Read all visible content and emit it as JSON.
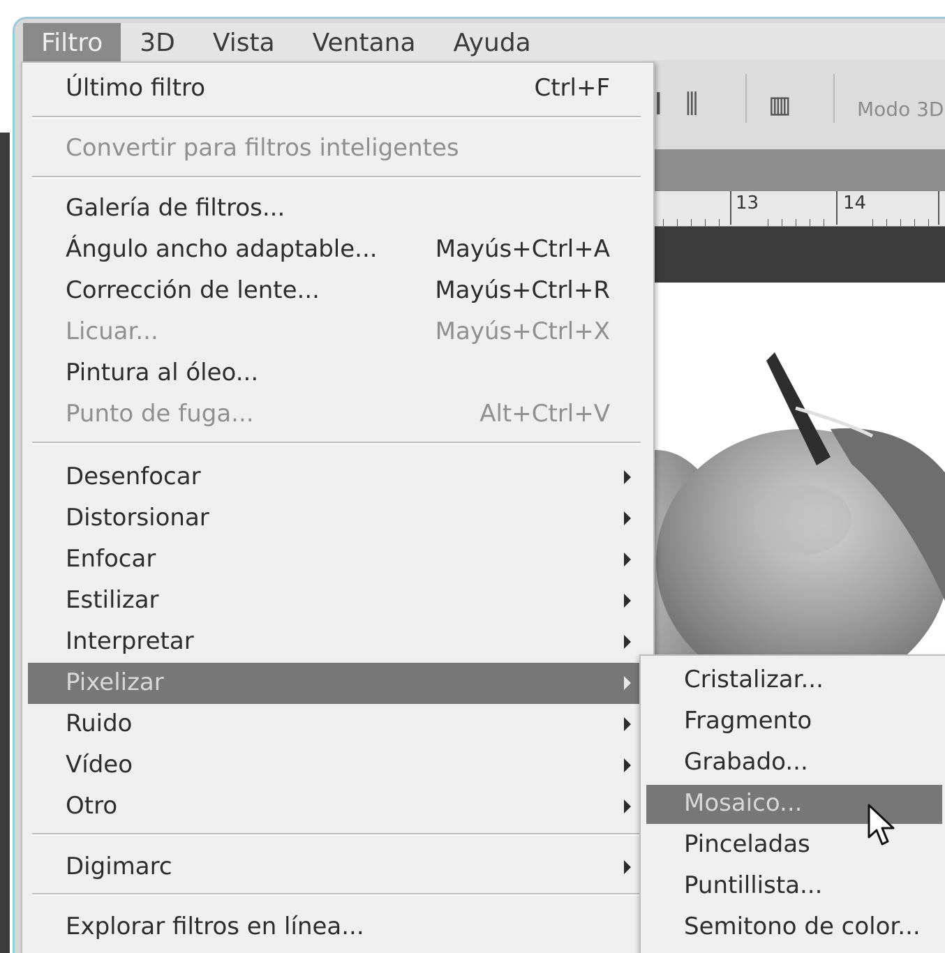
{
  "menubar": {
    "items": [
      "Filtro",
      "3D",
      "Vista",
      "Ventana",
      "Ayuda"
    ],
    "active_index": 0
  },
  "background": {
    "mode_label": "Modo 3D",
    "ruler": [
      "13",
      "14"
    ]
  },
  "filter_menu": {
    "last_filter": {
      "label": "Último filtro",
      "shortcut": "Ctrl+F",
      "enabled": true
    },
    "convert_smart": {
      "label": "Convertir para filtros inteligentes",
      "enabled": false
    },
    "filter_gallery": {
      "label": "Galería de filtros...",
      "enabled": true
    },
    "adaptive_wide_angle": {
      "label": "Ángulo ancho adaptable...",
      "shortcut": "Mayús+Ctrl+A",
      "enabled": true
    },
    "lens_correction": {
      "label": "Corrección de lente...",
      "shortcut": "Mayús+Ctrl+R",
      "enabled": true
    },
    "liquify": {
      "label": "Licuar...",
      "shortcut": "Mayús+Ctrl+X",
      "enabled": false
    },
    "oil_paint": {
      "label": "Pintura al óleo...",
      "enabled": true
    },
    "vanishing_point": {
      "label": "Punto de fuga...",
      "shortcut": "Alt+Ctrl+V",
      "enabled": false
    },
    "blur": {
      "label": "Desenfocar"
    },
    "distort": {
      "label": "Distorsionar"
    },
    "sharpen": {
      "label": "Enfocar"
    },
    "stylize": {
      "label": "Estilizar"
    },
    "render": {
      "label": "Interpretar"
    },
    "pixelate": {
      "label": "Pixelizar",
      "highlighted": true
    },
    "noise": {
      "label": "Ruido"
    },
    "video": {
      "label": "Vídeo"
    },
    "other": {
      "label": "Otro"
    },
    "digimarc": {
      "label": "Digimarc"
    },
    "browse_online": {
      "label": "Explorar filtros en línea..."
    }
  },
  "pixelate_submenu": {
    "items": [
      "Cristalizar...",
      "Fragmento",
      "Grabado...",
      "Mosaico...",
      "Pinceladas",
      "Puntillista...",
      "Semitono de color..."
    ],
    "highlighted_index": 3
  },
  "colors": {
    "menu_bg": "#efefef",
    "highlight_bg": "#777777",
    "disabled_text": "#8f8f8f"
  }
}
